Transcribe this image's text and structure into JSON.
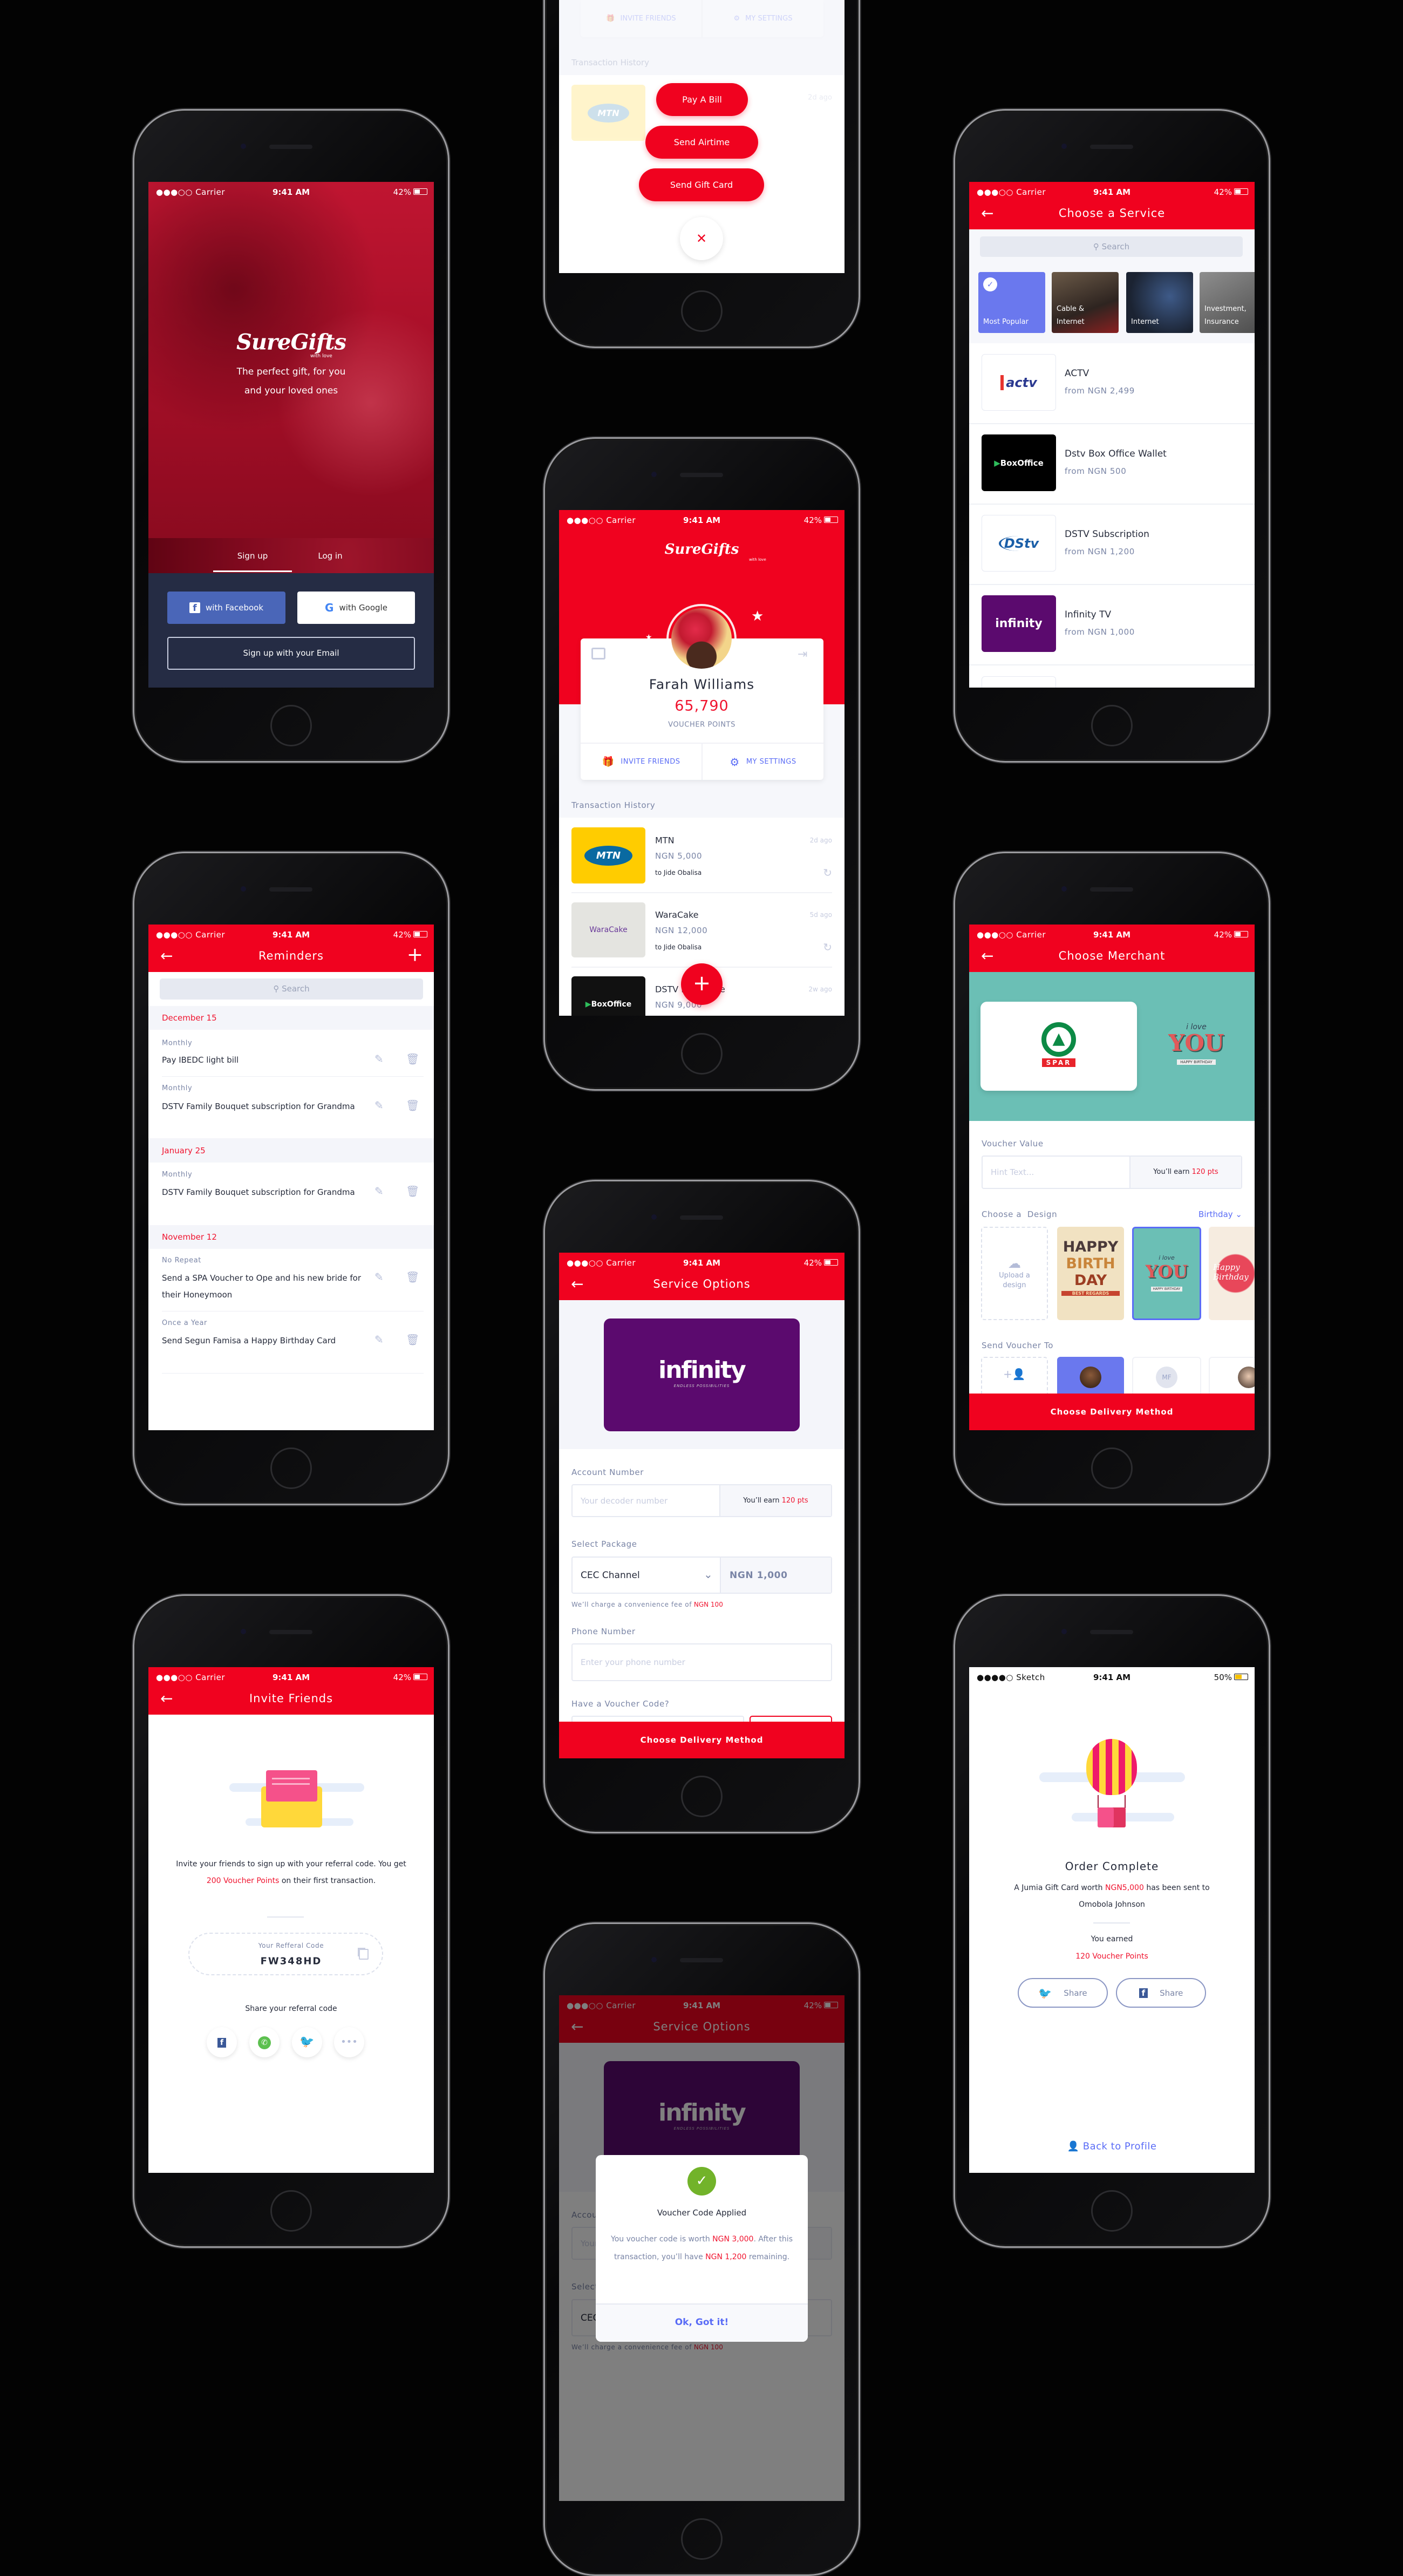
{
  "colors": {
    "brand_red": "#f0021f",
    "accent_blue": "#5a6cf6",
    "label": "#7a85a6",
    "navy": "#252c44",
    "teal": "#6bbfb5"
  },
  "status": {
    "carrier": "●●●○○ Carrier",
    "time": "9:41 AM",
    "battery": "42%"
  },
  "status_sketch": {
    "carrier": "●●●●○ Sketch",
    "time": "9:41 AM",
    "battery": "50%"
  },
  "signup": {
    "brand": "SureGifts",
    "brand_sub": "with love",
    "tagline_1": "The perfect gift, for you",
    "tagline_2": "and your loved ones",
    "tab_signup": "Sign up",
    "tab_login": "Log in",
    "facebook": "with Facebook",
    "google": "with Google",
    "email": "Sign up with your Email"
  },
  "quick_actions": {
    "invite": "INVITE FRIENDS",
    "settings": "MY SETTINGS",
    "history": "Transaction History",
    "first_logo": "MTN",
    "first_time": "2d ago",
    "pay_bill": "Pay A Bill",
    "send_airtime": "Send Airtime",
    "send_gift_card": "Send Gift Card",
    "close": "✕"
  },
  "profile": {
    "brand": "SureGifts",
    "brand_sub": "with love",
    "name": "Farah Williams",
    "points": "65,790",
    "points_label": "VOUCHER POINTS",
    "invite": "INVITE FRIENDS",
    "settings": "MY SETTINGS",
    "history_title": "Transaction History",
    "fab": "+",
    "transactions": [
      {
        "logo": "MTN",
        "merchant": "MTN",
        "amount": "NGN 5,000",
        "recipient": "to Jide Obalisa",
        "time": "2d ago"
      },
      {
        "logo": "WaraCake",
        "merchant": "WaraCake",
        "amount": "NGN 12,000",
        "recipient": "to Jide Obalisa",
        "time": "5d ago"
      },
      {
        "logo": "BoxOffice",
        "merchant": "DSTV Box Office",
        "amount": "NGN 9,000",
        "time": "2w ago"
      }
    ]
  },
  "choose_service": {
    "title": "Choose a Service",
    "search": "Search",
    "categories": [
      {
        "label": "Most Popular"
      },
      {
        "label": "Cable & Internet"
      },
      {
        "label": "Internet"
      },
      {
        "label": "Investment, Insurance"
      }
    ],
    "services": [
      {
        "logo": "actv",
        "name": "ACTV",
        "price": "from NGN 2,499"
      },
      {
        "logo": "BoxOffice",
        "name": "Dstv Box Office Wallet",
        "price": "from NGN 500"
      },
      {
        "logo": "DStv",
        "name": "DSTV Subscription",
        "price": "from NGN 1,200"
      },
      {
        "logo": "infinity",
        "name": "Infinity TV",
        "price": "from NGN 1,000"
      }
    ]
  },
  "reminders": {
    "title": "Reminders",
    "add": "+",
    "search": "Search",
    "groups": [
      {
        "date": "December 15",
        "items": [
          {
            "repeat": "Monthly",
            "text": "Pay IBEDC light bill"
          },
          {
            "repeat": "Monthly",
            "text": "DSTV Family Bouquet subscription for Grandma"
          }
        ]
      },
      {
        "date": "January 25",
        "items": [
          {
            "repeat": "Monthly",
            "text": "DSTV Family Bouquet subscription for Grandma"
          }
        ]
      },
      {
        "date": "November 12",
        "items": [
          {
            "repeat": "No Repeat",
            "text": "Send a SPA Voucher to Ope and his new bride for their Honeymoon"
          },
          {
            "repeat": "Once a Year",
            "text": "Send Segun Famisa a Happy Birthday Card"
          }
        ]
      }
    ]
  },
  "service_options": {
    "title": "Service Options",
    "logo": "infinity",
    "logo_tag": "ENDLESS POSSIBILITIES",
    "account_label": "Account Number",
    "account_placeholder": "Your decoder number",
    "earn_prefix": "You’ll earn",
    "earn_pts": "120 pts",
    "package_label": "Select Package",
    "package_value": "CEC Channel",
    "package_price": "NGN 1,000",
    "fee_prefix": "We’ll charge a convenience fee of",
    "fee_amount": "NGN 100",
    "phone_label": "Phone Number",
    "phone_placeholder": "Enter your phone number",
    "voucher_label": "Have a Voucher Code?",
    "cta": "Choose Delivery Method"
  },
  "merchant": {
    "title": "Choose Merchant",
    "merchant_logo": "SPAR",
    "preview": {
      "line1": "i love",
      "line2": "YOU",
      "line3": "HAPPY BIRTHDAY"
    },
    "voucher_label": "Voucher Value",
    "hint": "Hint Text...",
    "earn_prefix": "You’ll earn",
    "earn_pts": "120 pts",
    "design_label": "Choose a  Design",
    "design_filter": "Birthday",
    "upload": "Upload a design",
    "designs": [
      {
        "line1": "HAPPY",
        "line2": "BIRTH",
        "line3": "DAY",
        "line4": "BEST REGARDS"
      },
      {
        "line1": "i love",
        "line2": "YOU",
        "line3": "HAPPY BIRTHDAY"
      },
      {
        "line1": "Happy Birthday"
      }
    ],
    "send_label": "Send Voucher To",
    "contact_initials": "MF",
    "cta": "Choose Delivery Method"
  },
  "invite": {
    "title": "Invite Friends",
    "msg_pre": "Invite your friends to sign up with your referral code. You get ",
    "msg_highlight": "200 Voucher Points",
    "msg_post": " on their first transaction.",
    "code_label": "Your Refferal Code",
    "code": "FW348HD",
    "share_label": "Share your referral code"
  },
  "order": {
    "title": "Order Complete",
    "msg_pre": "A Jumia Gift Card worth ",
    "msg_amount": "NGN5,000",
    "msg_post": " has been sent to Omobola Johnson",
    "earned": "You earned",
    "points": "120 Voucher Points",
    "share_twitter": "Share",
    "share_facebook": "Share",
    "back": "Back to Profile"
  },
  "voucher_modal": {
    "title": "Voucher Code Applied",
    "line_pre": "You voucher code is worth ",
    "amount": "NGN 3,000",
    "line_mid": ". After this transaction, you’ll have ",
    "remaining": "NGN 1,200",
    "line_end": " remaining.",
    "ok": "Ok, Got it!"
  }
}
